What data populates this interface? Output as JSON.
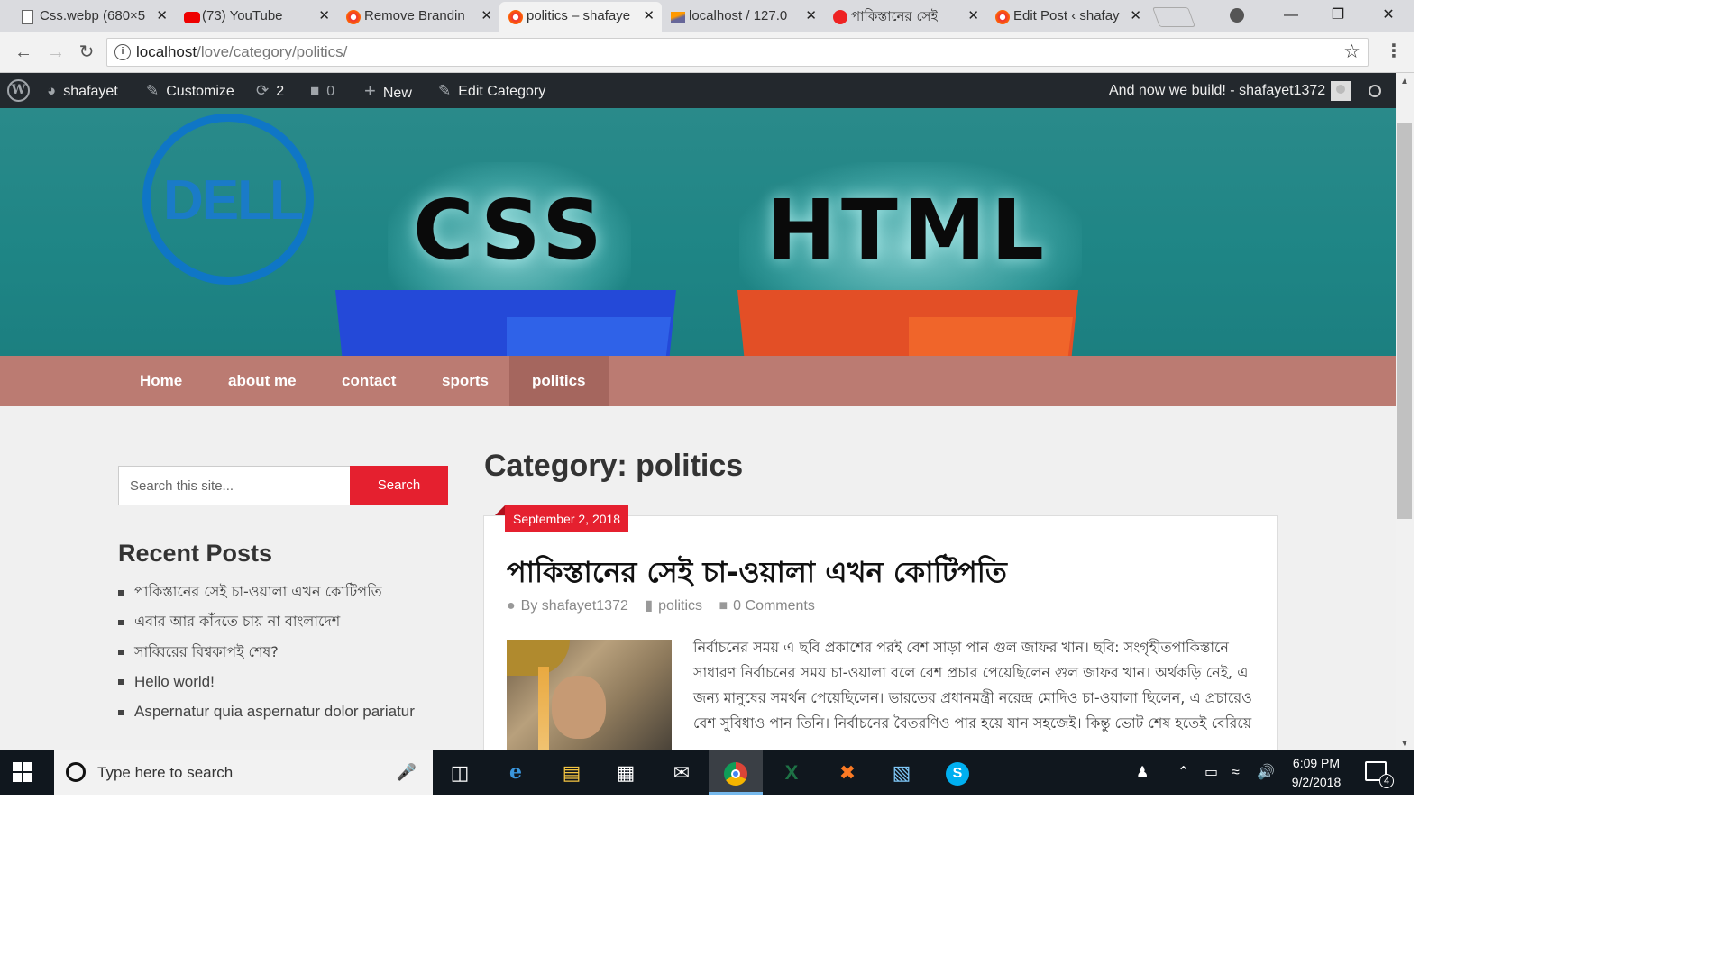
{
  "browser": {
    "tabs": [
      {
        "title": "Css.webp (680×5",
        "favicon": "file-icon",
        "active": false
      },
      {
        "title": "(73) YouTube",
        "favicon": "youtube-icon",
        "active": false
      },
      {
        "title": "Remove Brandin",
        "favicon": "site-icon",
        "active": false
      },
      {
        "title": "politics – shafaye",
        "favicon": "site-icon",
        "active": true
      },
      {
        "title": "localhost / 127.0",
        "favicon": "phpmyadmin-icon",
        "active": false
      },
      {
        "title": "পাকিস্তানের সেই",
        "favicon": "news-icon",
        "active": false
      },
      {
        "title": "Edit Post ‹ shafay",
        "favicon": "site-icon",
        "active": false
      }
    ],
    "url_host": "localhost",
    "url_path": "/love/category/politics/",
    "close_glyph": "✕"
  },
  "adminbar": {
    "site_name": "shafayet",
    "customize": "Customize",
    "updates": "2",
    "comments": "0",
    "new": "New",
    "edit_category": "Edit Category",
    "greeting": "And now we build! - shafayet1372"
  },
  "nav": {
    "items": [
      "Home",
      "about me",
      "contact",
      "sports",
      "politics"
    ],
    "current": "politics"
  },
  "header": {
    "logo_text": "DELL",
    "banner_left": "CSS",
    "banner_right": "HTML"
  },
  "sidebar": {
    "search_placeholder": "Search this site...",
    "search_button": "Search",
    "recent_title": "Recent Posts",
    "recent_posts": [
      "পাকিস্তানের সেই চা-ওয়ালা এখন কোটিপতি",
      "এবার আর কাঁদতে চায় না বাংলাদেশ",
      "সাব্বিরের বিশ্বকাপই শেষ?",
      "Hello world!",
      "Aspernatur quia aspernatur dolor pariatur"
    ]
  },
  "main": {
    "category_title": "Category: politics",
    "post": {
      "date": "September 2, 2018",
      "title": "পাকিস্তানের সেই চা-ওয়ালা এখন কোটিপতি",
      "author": "By shafayet1372",
      "category": "politics",
      "comments": "0 Comments",
      "excerpt": "নির্বাচনের সময় এ ছবি প্রকাশের পরই বেশ সাড়া পান গুল জাফর খান। ছবি: সংগৃহীতপাকিস্তানে সাধারণ নির্বাচনের সময় চা-ওয়ালা বলে বেশ প্রচার পেয়েছিলেন গুল জাফর খান। অর্থকড়ি নেই, এ জন্য মানুষের সমর্থন পেয়েছিলেন। ভারতের প্রধানমন্ত্রী নরেন্দ্র মোদিও চা-ওয়ালা ছিলেন, এ প্রচারেও বেশ সুবিধাও পান তিনি। নির্বাচনের বৈতরণিও পার হয়ে যান সহজেই। কিন্তু ভোট শেষ হতেই বেরিয়ে"
    }
  },
  "taskbar": {
    "search_placeholder": "Type here to search",
    "time": "6:09 PM",
    "date": "9/2/2018",
    "notifications": "4"
  },
  "colors": {
    "accent_red": "#e5202f",
    "nav_bg": "#bb7b72",
    "nav_current": "#a5665e",
    "header_teal": "#1e8585",
    "adminbar_bg": "#23282d"
  }
}
